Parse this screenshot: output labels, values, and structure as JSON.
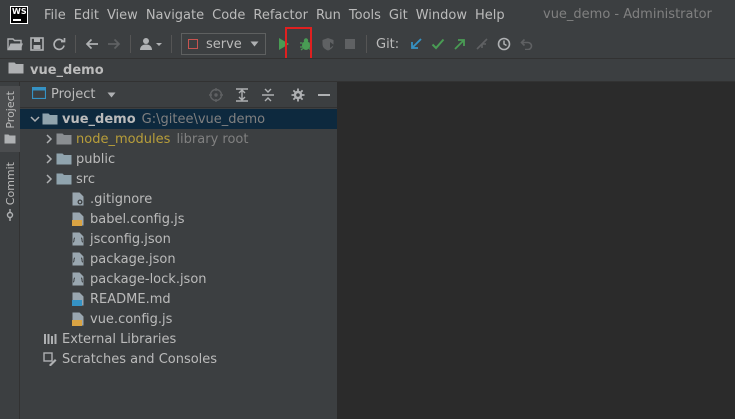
{
  "app": {
    "logo_text": "WS",
    "window_title": "vue_demo - Administrator"
  },
  "menu": [
    "File",
    "Edit",
    "View",
    "Navigate",
    "Code",
    "Refactor",
    "Run",
    "Tools",
    "Git",
    "Window",
    "Help"
  ],
  "toolbar": {
    "run_config": "serve",
    "git_label": "Git:",
    "icons": [
      "open-folder-icon",
      "save-icon",
      "sync-icon",
      "back-arrow-icon",
      "forward-arrow-icon",
      "user-icon",
      "run-icon",
      "debug-icon",
      "coverage-icon",
      "stop-icon",
      "git-update-icon",
      "git-commit-icon",
      "git-push-icon",
      "git-merge-icon",
      "history-icon",
      "rollback-icon"
    ],
    "colors": {
      "run": "#499c54",
      "highlight": "#e02020",
      "git_update": "#3592c4",
      "git_commit": "#499c54"
    }
  },
  "navbar": {
    "project": "vue_demo"
  },
  "left_tabs": {
    "project": "Project",
    "commit": "Commit"
  },
  "panel": {
    "title": "Project"
  },
  "tree": {
    "root": {
      "name": "vue_demo",
      "path": "G:\\gitee\\vue_demo"
    },
    "node_modules": {
      "name": "node_modules",
      "note": "library root"
    },
    "folders": [
      "public",
      "src"
    ],
    "files": [
      ".gitignore",
      "babel.config.js",
      "jsconfig.json",
      "package.json",
      "package-lock.json",
      "README.md",
      "vue.config.js"
    ],
    "external": "External Libraries",
    "scratches": "Scratches and Consoles"
  }
}
